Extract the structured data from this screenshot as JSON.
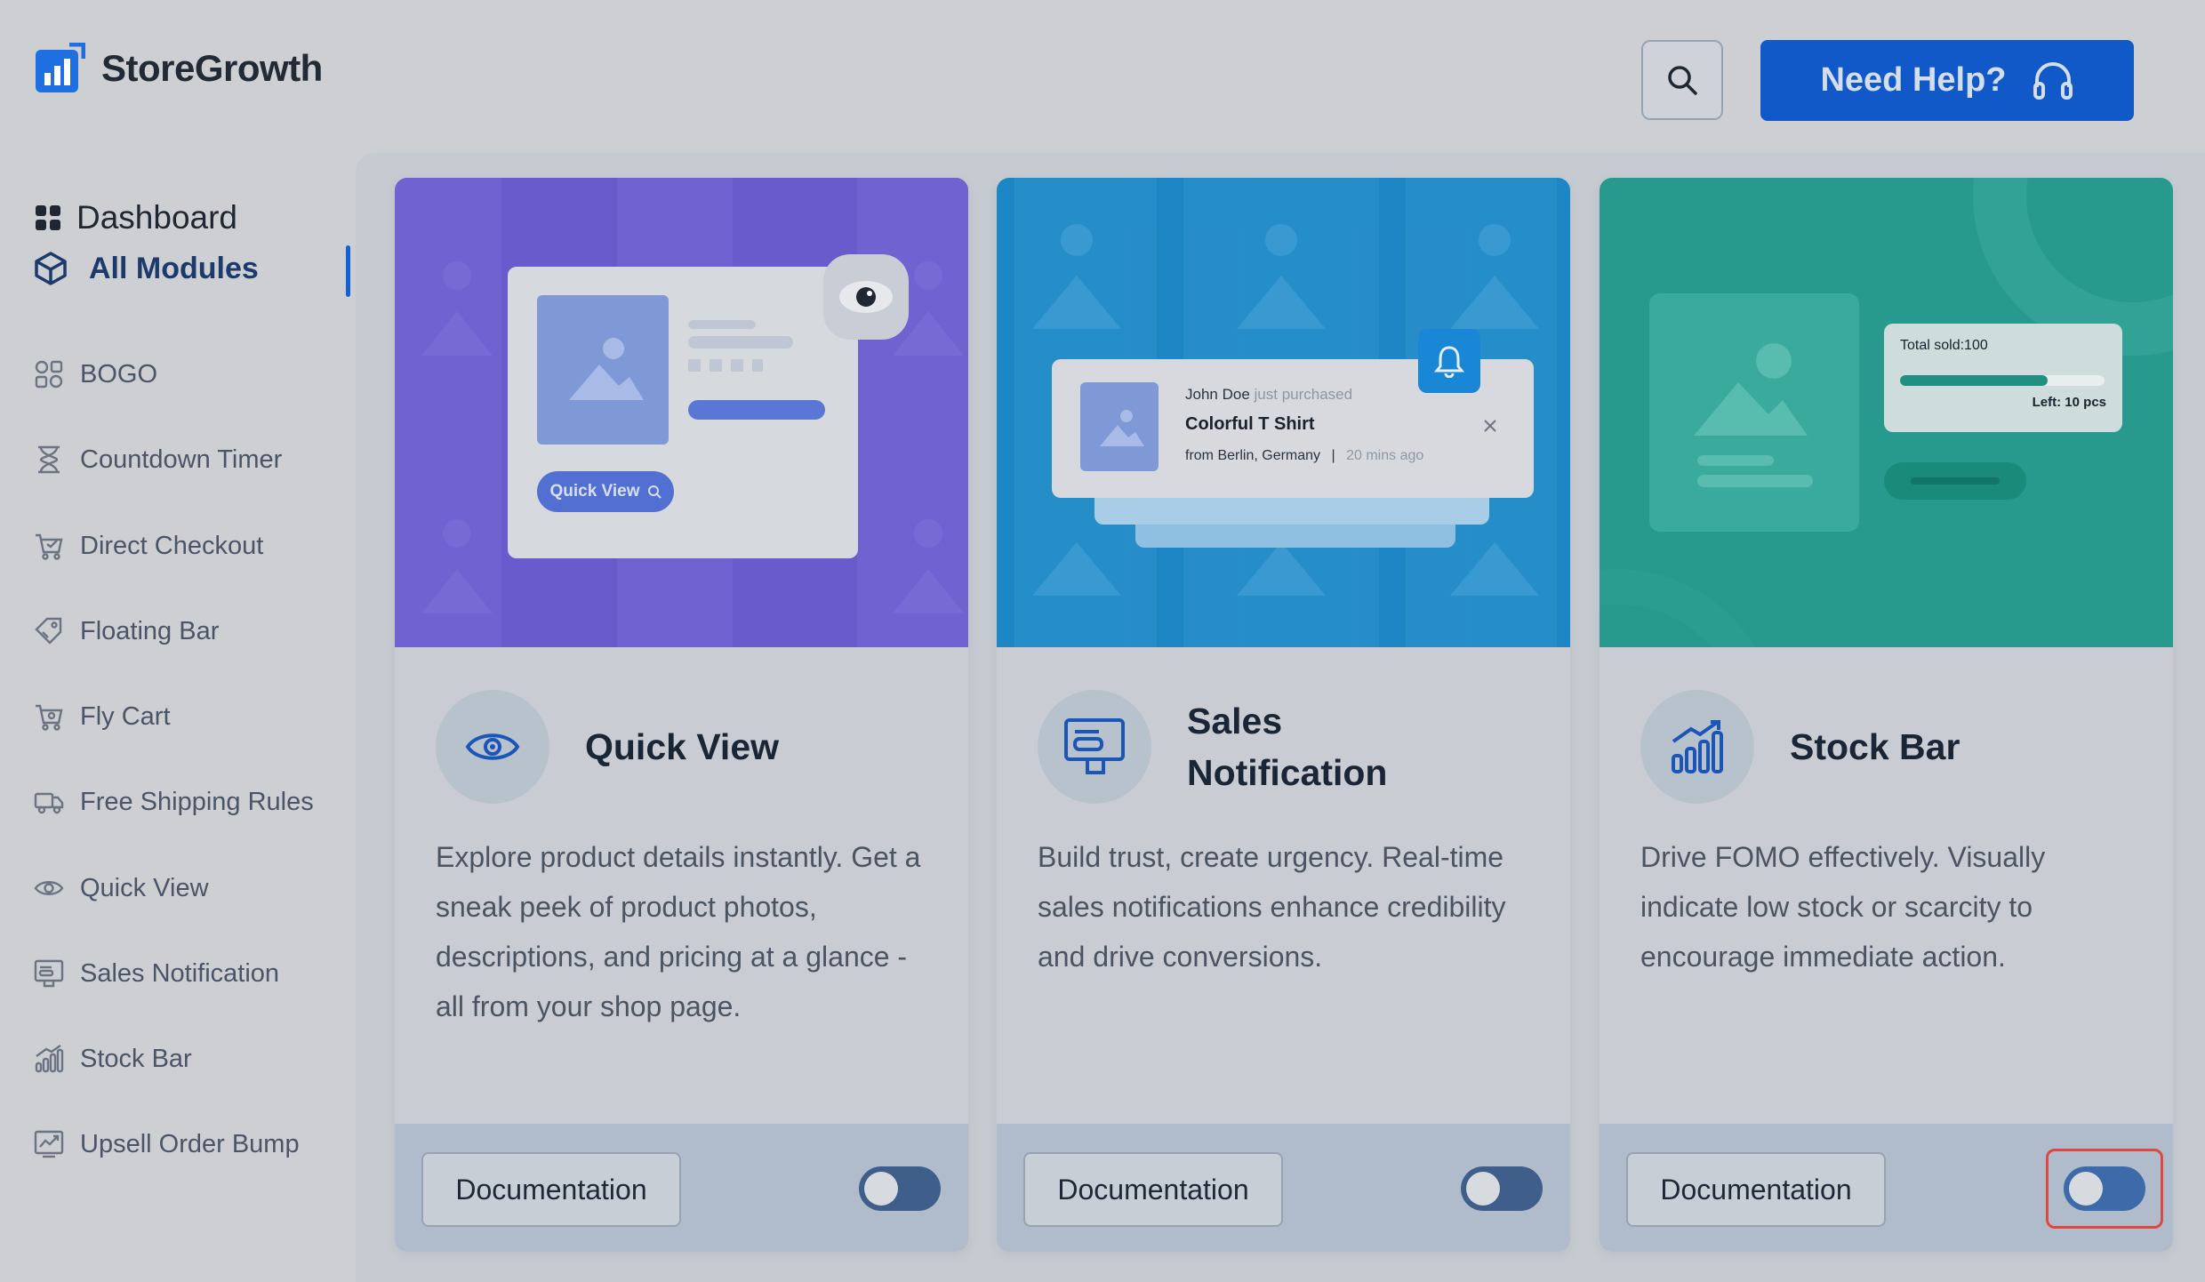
{
  "brand": {
    "name": "StoreGrowth"
  },
  "header": {
    "help_label": "Need Help?"
  },
  "sidebar": {
    "dashboard": "Dashboard",
    "all_modules": "All Modules",
    "items": [
      {
        "label": "BOGO",
        "icon": "bogo-icon"
      },
      {
        "label": "Countdown Timer",
        "icon": "hourglass-icon"
      },
      {
        "label": "Direct Checkout",
        "icon": "cart-icon"
      },
      {
        "label": "Floating Bar",
        "icon": "tag-icon"
      },
      {
        "label": "Fly Cart",
        "icon": "cart-fly-icon"
      },
      {
        "label": "Free Shipping Rules",
        "icon": "truck-icon"
      },
      {
        "label": "Quick View",
        "icon": "eye-icon"
      },
      {
        "label": "Sales Notification",
        "icon": "monitor-icon"
      },
      {
        "label": "Stock Bar",
        "icon": "bar-chart-icon"
      },
      {
        "label": "Upsell Order Bump",
        "icon": "trend-icon"
      }
    ]
  },
  "cards": [
    {
      "title": "Quick View",
      "description": "Explore product details instantly. Get a sneak peek of product photos, descriptions, and pricing at a glance - all from your shop page.",
      "doc_label": "Documentation",
      "hero": {
        "button_label": "Quick View"
      },
      "enabled": true
    },
    {
      "title": "Sales Notification",
      "description": "Build trust, create urgency. Real-time sales notifications enhance credibility and drive conversions.",
      "doc_label": "Documentation",
      "hero": {
        "buyer": "John Doe",
        "action": "just purchased",
        "product": "Colorful T Shirt",
        "location": "from Berlin, Germany",
        "separator": "|",
        "time": "20 mins ago"
      },
      "enabled": true
    },
    {
      "title": "Stock Bar",
      "description": "Drive FOMO effectively. Visually indicate low stock or scarcity to encourage immediate action.",
      "doc_label": "Documentation",
      "hero": {
        "sold": "Total sold:100",
        "left": "Left: 10 pcs",
        "sold_fraction": 0.72
      },
      "enabled": false
    }
  ]
}
